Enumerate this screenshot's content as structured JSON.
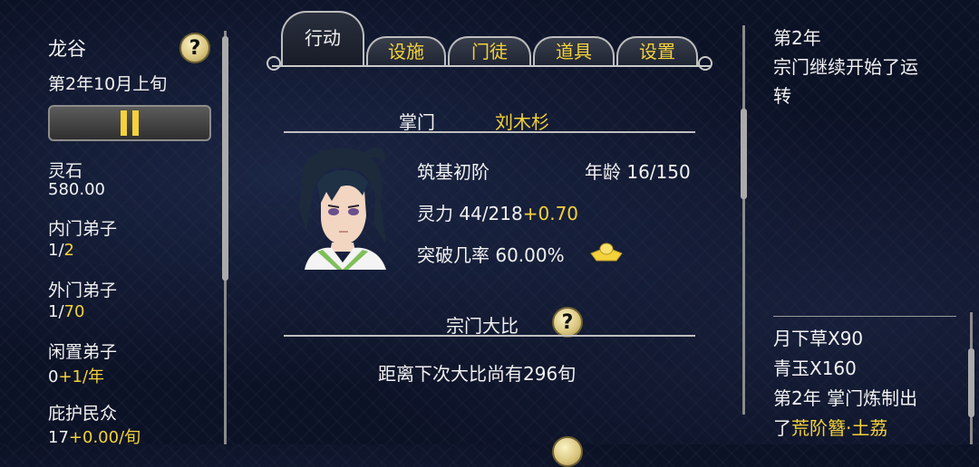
{
  "left_panel": {
    "location": "龙谷",
    "date": "第2年10月上旬",
    "stats": [
      {
        "label": "灵石",
        "value": "580.00"
      },
      {
        "label": "内门弟子",
        "value_a": "1/",
        "value_b": "2"
      },
      {
        "label": "外门弟子",
        "value_a": "1/",
        "value_b": "70"
      },
      {
        "label": "闲置弟子",
        "value_a": "0",
        "value_b": "+1/年"
      },
      {
        "label": "庇护民众",
        "value_a": "17",
        "value_b": "+0.00/旬"
      }
    ],
    "help_glyph": "?"
  },
  "tabs": [
    {
      "label": "行动",
      "active": true
    },
    {
      "label": "设施"
    },
    {
      "label": "门徒"
    },
    {
      "label": "道具"
    },
    {
      "label": "设置"
    }
  ],
  "leader": {
    "title_label": "掌门",
    "name": "刘木杉",
    "realm": "筑基初阶",
    "age_label": "年龄",
    "age_value": "16/150",
    "spirit_label": "灵力",
    "spirit_value": "44/218",
    "spirit_rate": "+0.70",
    "breakthrough_label": "突破几率",
    "breakthrough_value": "60.00%"
  },
  "tournament": {
    "title": "宗门大比",
    "help_glyph": "?",
    "countdown": "距离下次大比尚有296旬"
  },
  "log_top": {
    "lines": [
      "第2年",
      "宗门继续开始了运",
      "转"
    ]
  },
  "log_bottom": {
    "lines": [
      {
        "text": "月下草X90"
      },
      {
        "text": "青玉X160"
      },
      {
        "text": "第2年 掌门炼制出"
      },
      {
        "text_a": "了",
        "text_b": "荒阶簪·土荔"
      }
    ]
  },
  "colors": {
    "accent_yellow": "#f3d23a",
    "text_white": "#f2f2f2",
    "background": "#0c1226"
  },
  "icons": {
    "help": "question-mark-icon",
    "pause": "pause-icon",
    "breakthrough": "gold-ingot-icon"
  }
}
